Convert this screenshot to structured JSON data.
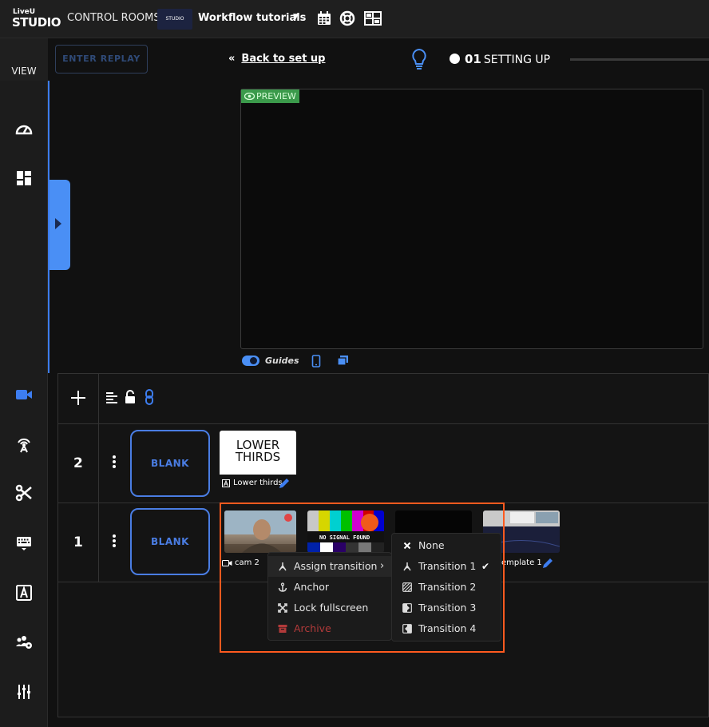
{
  "colors": {
    "accent": "#4a8ff5",
    "highlight": "#ff5a1f",
    "preview_badge": "#3b9a4b",
    "danger": "#b23a3a"
  },
  "topbar": {
    "logo_top": "LiveU",
    "logo_bottom": "STUDIO",
    "nav_label": "CONTROL ROOMS",
    "project_thumb_text": "STUDIO",
    "project_name": "Workflow tutorials",
    "icons": [
      "calendar-icon",
      "help-ring-icon",
      "layout-icon"
    ]
  },
  "sidebar": {
    "view_label": "VIEW",
    "icons": [
      "dashboard-icon",
      "layout-grid-icon",
      "camera-icon",
      "antenna-icon",
      "scissors-icon",
      "keyboard-icon",
      "text-icon",
      "users-gear-icon",
      "sliders-icon"
    ]
  },
  "toolbar": {
    "replay_label": "ENTER REPLAY",
    "back_arrow": "«",
    "back_label": "Back to set up",
    "status_number": "01",
    "status_label": "SETTING UP"
  },
  "preview": {
    "badge": "PREVIEW",
    "guides_label": "Guides"
  },
  "layers": {
    "rows": [
      {
        "number": "2",
        "blank_label": "BLANK"
      },
      {
        "number": "1",
        "blank_label": "BLANK"
      }
    ],
    "lower_thirds": {
      "thumb_text_1": "LOWER",
      "thumb_text_2": "THIRDS",
      "label": "Lower thirds"
    },
    "sources": {
      "cam_label": "cam 2",
      "nosignal_text": "NO SIGNAL FOUND",
      "template_label": "emplate 1"
    }
  },
  "menu": {
    "items": [
      {
        "label": "Assign transition",
        "arrow": "›"
      },
      {
        "label": "Anchor"
      },
      {
        "label": "Lock fullscreen"
      },
      {
        "label": "Archive"
      }
    ]
  },
  "submenu": {
    "items": [
      {
        "label": "None"
      },
      {
        "label": "Transition 1",
        "checked": "✔"
      },
      {
        "label": "Transition 2"
      },
      {
        "label": "Transition 3"
      },
      {
        "label": "Transition 4"
      }
    ]
  }
}
